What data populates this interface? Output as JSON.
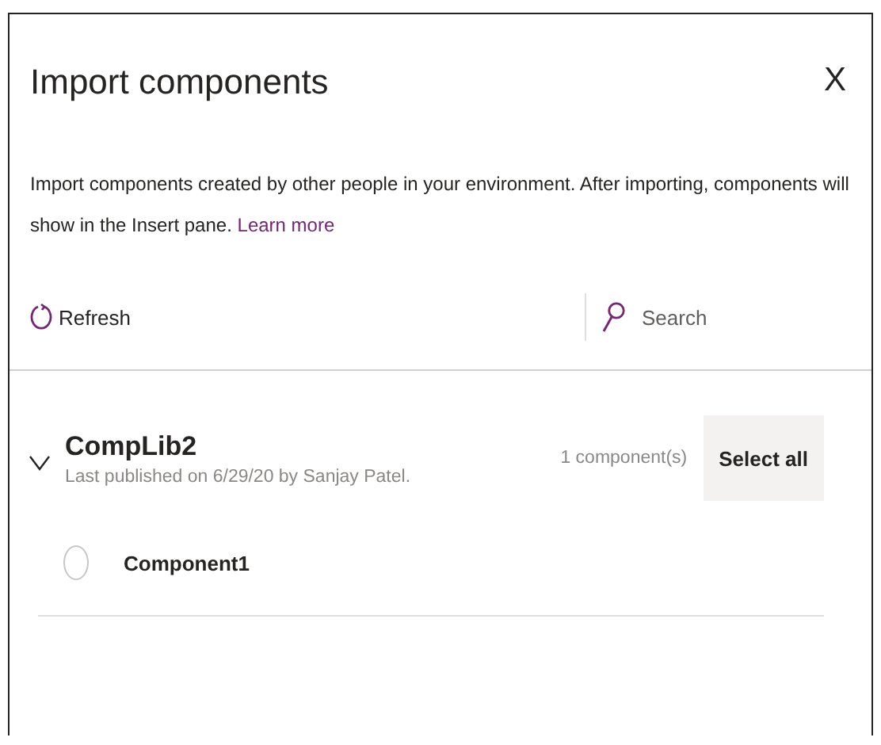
{
  "dialog": {
    "title": "Import components",
    "close": "X",
    "description": "Import components created by other people in your environment. After importing, components will show in the Insert pane.",
    "learn_more": "Learn more"
  },
  "toolbar": {
    "refresh": "Refresh",
    "search": {
      "placeholder": "Search"
    }
  },
  "libraries": [
    {
      "name": "CompLib2",
      "published": "Last published on 6/29/20 by Sanjay Patel.",
      "count": "1 component(s)",
      "select_all": "Select all",
      "expanded": true,
      "components": [
        {
          "name": "Component1",
          "selected": false
        }
      ]
    }
  ]
}
